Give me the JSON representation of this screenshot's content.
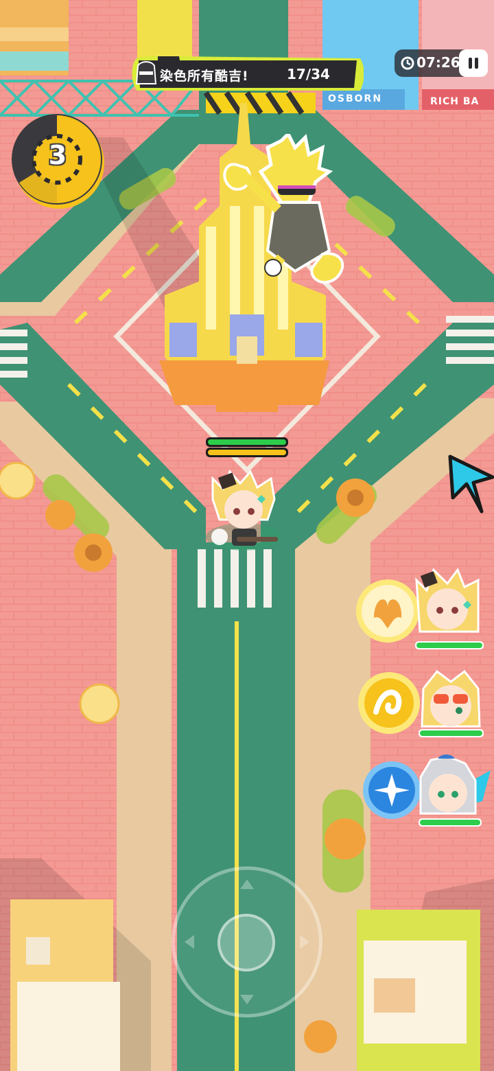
{
  "hud": {
    "objective_text": "染色所有酷吉!",
    "objective_progress": "17/34",
    "timer": "07:26",
    "wave_number": "3"
  },
  "map": {
    "storefront_signs": [
      "OSBORN",
      "RICH BA"
    ]
  },
  "party": [
    {
      "member": "blonde-cat-ear-girl",
      "skill_icon": "orange-burst-icon",
      "health": 1.0
    },
    {
      "member": "blonde-sunglasses-girl",
      "skill_icon": "orange-swirl-icon",
      "health": 1.0
    },
    {
      "member": "silver-hair-girl",
      "skill_icon": "blue-flower-icon",
      "health": 1.0
    }
  ],
  "player": {
    "health": 1.0,
    "energy": 1.0
  },
  "colors": {
    "ground_pink": "#f08f8a",
    "road_green": "#3f9274",
    "road_line": "#f4e14a",
    "accent_yellow": "#f6c21b",
    "banner_dark": "#2a2a2e",
    "health_green": "#2ecc4b"
  }
}
